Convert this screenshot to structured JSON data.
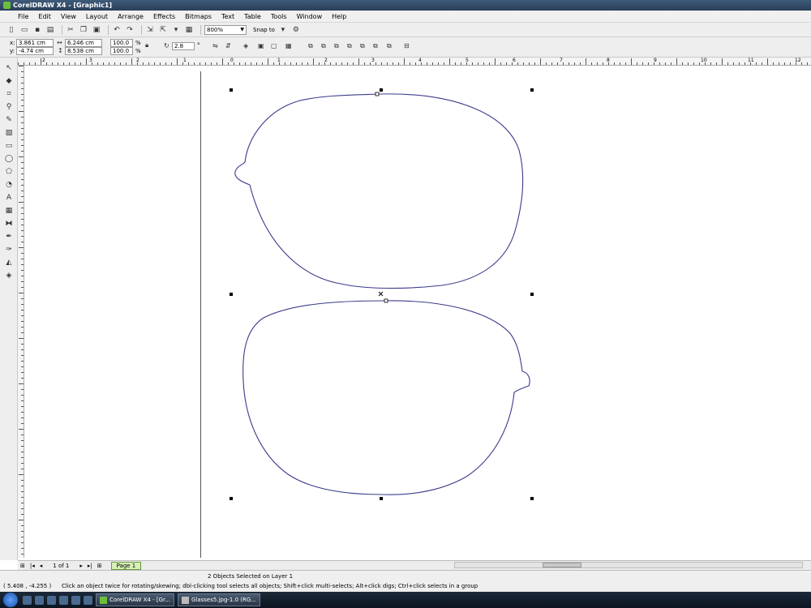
{
  "window": {
    "title": "CorelDRAW X4 - [Graphic1]"
  },
  "menu": [
    "File",
    "Edit",
    "View",
    "Layout",
    "Arrange",
    "Effects",
    "Bitmaps",
    "Text",
    "Table",
    "Tools",
    "Window",
    "Help"
  ],
  "toolbar": {
    "zoom": "800%",
    "snap_to": "Snap to"
  },
  "properties": {
    "x_label": "x:",
    "x": "3.861 cm",
    "y_label": "y:",
    "y": "-4.74 cm",
    "width": "6.246 cm",
    "height": "8.538 cm",
    "scale_x": "100.0",
    "scale_y": "100.0",
    "percent": "%",
    "angle": "2.8",
    "degree": "°"
  },
  "ruler_h_labels": [
    "2",
    "3",
    "2",
    "1",
    "0",
    "1",
    "2",
    "3",
    "4",
    "5",
    "6",
    "7",
    "8",
    "9",
    "10",
    "11",
    "12"
  ],
  "page_nav": {
    "counter": "1 of 1",
    "page_tab": "Page 1"
  },
  "status": {
    "selection": "2 Objects Selected on Layer 1",
    "coords": "( 5.408 , -4.255 )",
    "hint": "Click an object twice for rotating/skewing; dbl-clicking tool selects all objects; Shift+click multi-selects; Alt+click digs; Ctrl+click selects in a group"
  },
  "taskbar": {
    "task1": "CorelDRAW X4 - [Gr...",
    "task2": "Glasses5.jpg-1.0 (RG..."
  },
  "colors": {
    "curve": "#3a3a8c",
    "page_tab": "#d6f0b6"
  }
}
